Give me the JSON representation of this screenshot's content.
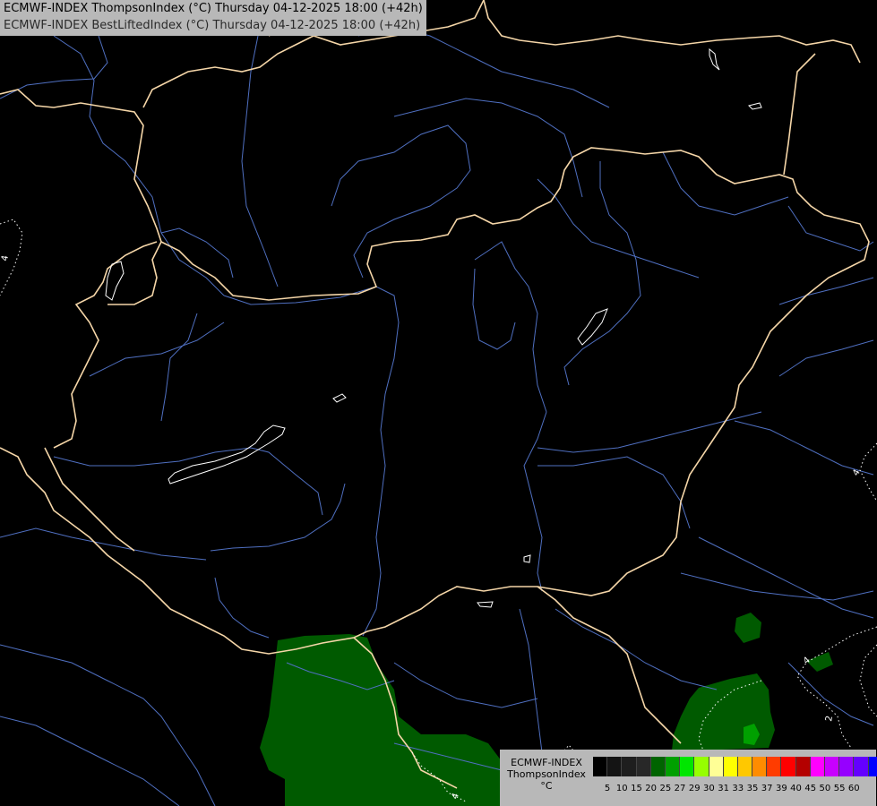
{
  "title": {
    "line1": "ECMWF-INDEX ThompsonIndex (°C) Thursday 04-12-2025 18:00 (+42h)",
    "line2": "ECMWF-INDEX BestLiftedIndex (°C) Thursday 04-12-2025 18:00 (+42h)"
  },
  "legend": {
    "label_line1": "ECMWF-INDEX",
    "label_line2": "ThompsonIndex",
    "label_line3": "°C",
    "colors": [
      "#000000",
      "#141414",
      "#1e1e1e",
      "#282828",
      "#006400",
      "#00a000",
      "#00e600",
      "#96ff00",
      "#ffff96",
      "#ffff00",
      "#ffc800",
      "#ff8c00",
      "#ff3c00",
      "#ff0000",
      "#b40000",
      "#ff00ff",
      "#c800ff",
      "#9600ff",
      "#6400ff",
      "#0000ff"
    ],
    "ticks": [
      "5",
      "10",
      "15",
      "20",
      "25",
      "27",
      "29",
      "30",
      "31",
      "33",
      "35",
      "37",
      "39",
      "40",
      "45",
      "50",
      "55",
      "60"
    ]
  },
  "contour_labels": [
    {
      "id": "west",
      "text": "4"
    },
    {
      "id": "east",
      "text": "4"
    },
    {
      "id": "se1",
      "text": "4"
    },
    {
      "id": "se2",
      "text": "2"
    },
    {
      "id": "south",
      "text": "4"
    }
  ],
  "colors": {
    "background": "#000000",
    "border": "#f5d6a8",
    "river": "#4f6fc0",
    "lake": "#ffffff",
    "thompson_fill": "#005a00",
    "thompson_fill_light": "#009600"
  }
}
